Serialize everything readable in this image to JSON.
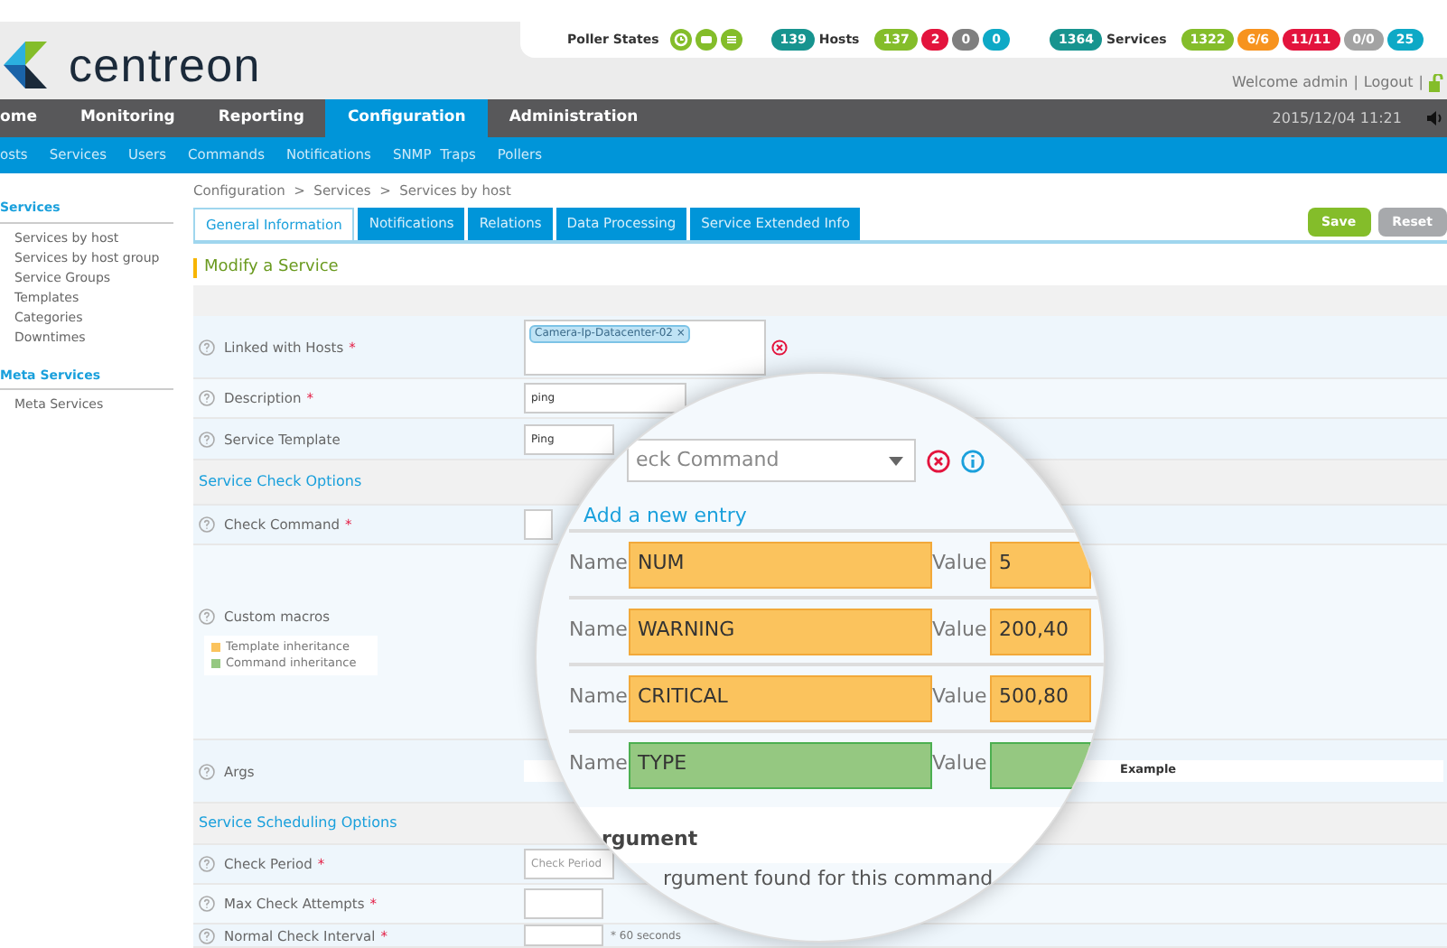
{
  "header": {
    "logo": "centreon",
    "poller_label": "Poller States",
    "host_total": "139",
    "hosts_label": "Hosts",
    "host_counts": [
      {
        "text": "137",
        "color": "#84bd2a"
      },
      {
        "text": "2",
        "color": "#e3143d"
      },
      {
        "text": "0",
        "color": "#7f7f7f"
      },
      {
        "text": "0",
        "color": "#0ea9c6"
      }
    ],
    "service_total": "1364",
    "services_label": "Services",
    "service_counts": [
      {
        "text": "1322",
        "color": "#84bd2a"
      },
      {
        "text": "6/6",
        "color": "#f7931e"
      },
      {
        "text": "11/11",
        "color": "#e3143d"
      },
      {
        "text": "0/0",
        "color": "#a3a3a3"
      },
      {
        "text": "25",
        "color": "#0ea9c6"
      }
    ],
    "welcome": "Welcome admin",
    "separator_1": "|",
    "logout": "Logout",
    "separator_2": "|"
  },
  "main_menu": [
    {
      "label": "ome",
      "selected": false
    },
    {
      "label": "Monitoring",
      "selected": false
    },
    {
      "label": "Reporting",
      "selected": false
    },
    {
      "label": "Configuration",
      "selected": true
    },
    {
      "label": "Administration",
      "selected": false
    }
  ],
  "datetime": "2015/12/04 11:21",
  "sub_menu": [
    "osts",
    "Services",
    "Users",
    "Commands",
    "Notifications",
    "SNMP  Traps",
    "Pollers"
  ],
  "sidebar": [
    {
      "title": "Services",
      "items": [
        "Services by host",
        "Services by host group",
        "Service Groups",
        "Templates",
        "Categories",
        "Downtimes"
      ]
    },
    {
      "title": "Meta Services",
      "items": [
        "Meta Services"
      ]
    }
  ],
  "breadcrumb": "Configuration  >  Services  >  Services by host",
  "tabs": [
    {
      "label": "General Information",
      "selected": true
    },
    {
      "label": "Notifications",
      "selected": false
    },
    {
      "label": "Relations",
      "selected": false
    },
    {
      "label": "Data Processing",
      "selected": false
    },
    {
      "label": "Service Extended Info",
      "selected": false
    }
  ],
  "buttons": [
    {
      "label": "Save",
      "kind": "primary"
    },
    {
      "label": "Reset",
      "kind": "secondary"
    }
  ],
  "form_title": "Modify a Service",
  "rows": [
    {
      "kind": "tags",
      "label": "Linked with Hosts",
      "required_mark": "*",
      "tags": [
        "Camera-Ip-Datacenter-02 ×"
      ]
    },
    {
      "kind": "text",
      "label": "Description",
      "required_mark": "*",
      "value": "ping"
    },
    {
      "kind": "text",
      "label": "Service Template",
      "value": "Ping"
    },
    {
      "kind": "section",
      "label": "Service Check Options"
    },
    {
      "kind": "text",
      "label": "Check Command",
      "required_mark": "*"
    },
    {
      "kind": "macros",
      "label": "Custom macros",
      "legend": [
        {
          "label": "Template inheritance",
          "color": "#fbc35d"
        },
        {
          "label": "Command inheritance",
          "color": "#95c881"
        }
      ]
    },
    {
      "kind": "args",
      "label": "Args",
      "column": "Example"
    },
    {
      "kind": "section",
      "label": "Service Scheduling Options"
    },
    {
      "kind": "text",
      "label": "Check Period",
      "required_mark": "*",
      "placeholder": "Check Period"
    },
    {
      "kind": "text",
      "label": "Max Check Attempts",
      "required_mark": "*"
    },
    {
      "kind": "text",
      "label": "Normal Check Interval",
      "required_mark": "*",
      "suffix": "* 60 seconds"
    }
  ],
  "magnifier": {
    "command_placeholder": "eck Command",
    "add_entry": "Add a new entry",
    "macros": [
      {
        "name_label": "Name",
        "name": "NUM",
        "value_label": "Value",
        "value": "5",
        "kind": "template"
      },
      {
        "name_label": "Name",
        "name": "WARNING",
        "value_label": "Value",
        "value": "200,40",
        "kind": "template"
      },
      {
        "name_label": "Name",
        "name": "CRITICAL",
        "value_label": "Value",
        "value": "500,80",
        "kind": "template"
      },
      {
        "name_label": "Name",
        "name": "TYPE",
        "value_label": "Value",
        "kind": "command"
      }
    ],
    "argument_heading": "rgument",
    "argument_empty": "rgument found for this command"
  }
}
